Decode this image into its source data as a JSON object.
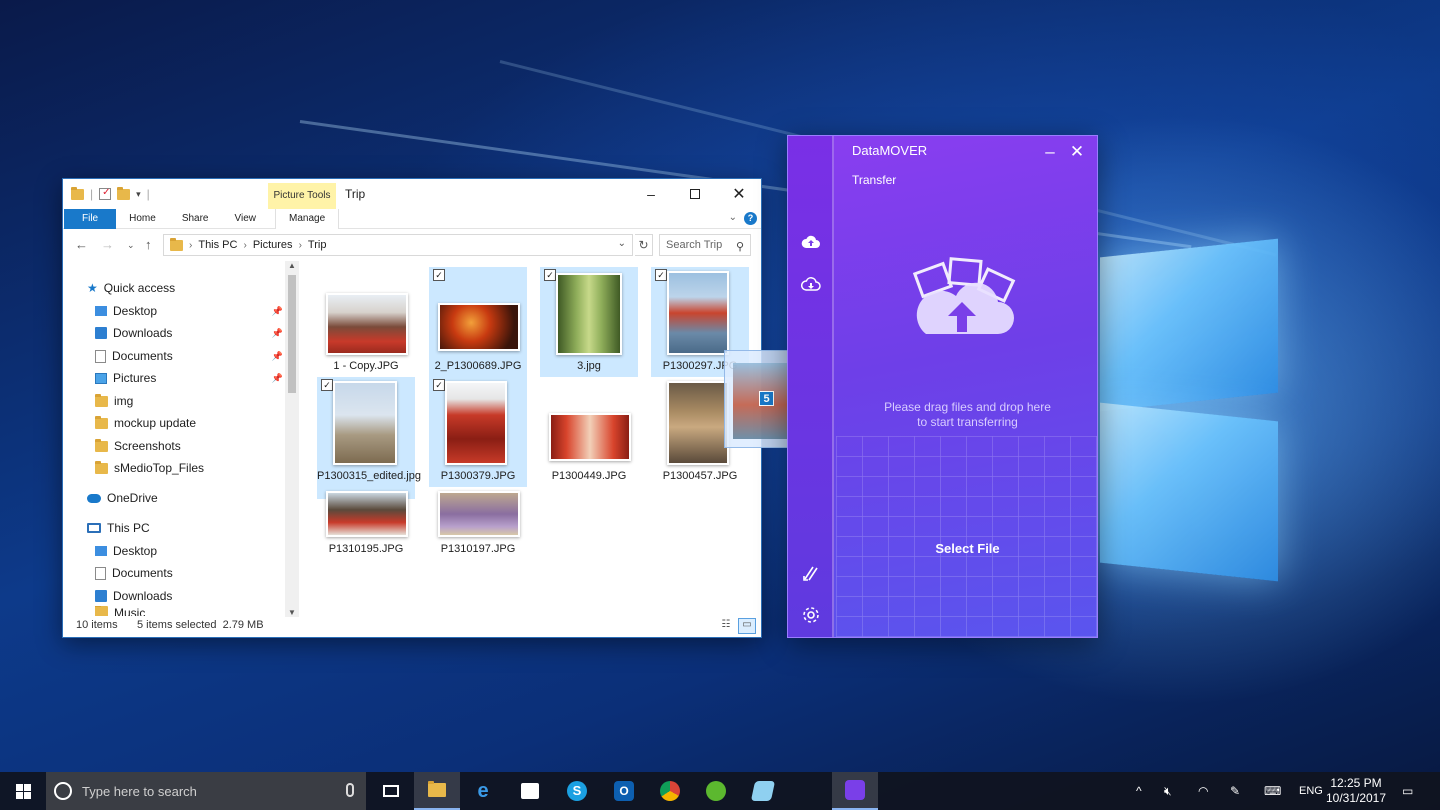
{
  "explorer": {
    "title": "Trip",
    "context_tab": "Picture Tools",
    "ribbon_tabs": [
      "File",
      "Home",
      "Share",
      "View",
      "Manage"
    ],
    "breadcrumb": [
      "This PC",
      "Pictures",
      "Trip"
    ],
    "search_placeholder": "Search Trip",
    "nav": {
      "quick_access": "Quick access",
      "quick_items": [
        "Desktop",
        "Downloads",
        "Documents",
        "Pictures",
        "img",
        "mockup update",
        "Screenshots",
        "sMedioTop_Files"
      ],
      "onedrive": "OneDrive",
      "this_pc": "This PC",
      "pc_items": [
        "Desktop",
        "Documents",
        "Downloads",
        "Music"
      ]
    },
    "files": [
      {
        "name": "1 - Copy.JPG",
        "selected": false
      },
      {
        "name": "2_P1300689.JPG",
        "selected": true
      },
      {
        "name": "3.jpg",
        "selected": true
      },
      {
        "name": "P1300297.JPG",
        "selected": true
      },
      {
        "name": "P1300315_edited.jpg",
        "selected": true
      },
      {
        "name": "P1300379.JPG",
        "selected": true
      },
      {
        "name": "P1300449.JPG",
        "selected": false
      },
      {
        "name": "P1300457.JPG",
        "selected": false
      },
      {
        "name": "P1310195.JPG",
        "selected": false
      },
      {
        "name": "P1310197.JPG",
        "selected": false
      }
    ],
    "status": {
      "item_count": "10 items",
      "selection": "5 items selected  2.79 MB"
    }
  },
  "drag": {
    "count": "5"
  },
  "datamover": {
    "title": "DataMOVER",
    "section": "Transfer",
    "message_line1": "Please drag files and drop here",
    "message_line2": "to start transferring",
    "select_label": "Select File",
    "accent": "#7a3fe8"
  },
  "taskbar": {
    "search_placeholder": "Type here to search",
    "language": "ENG",
    "time": "12:25 PM",
    "date": "10/31/2017"
  }
}
